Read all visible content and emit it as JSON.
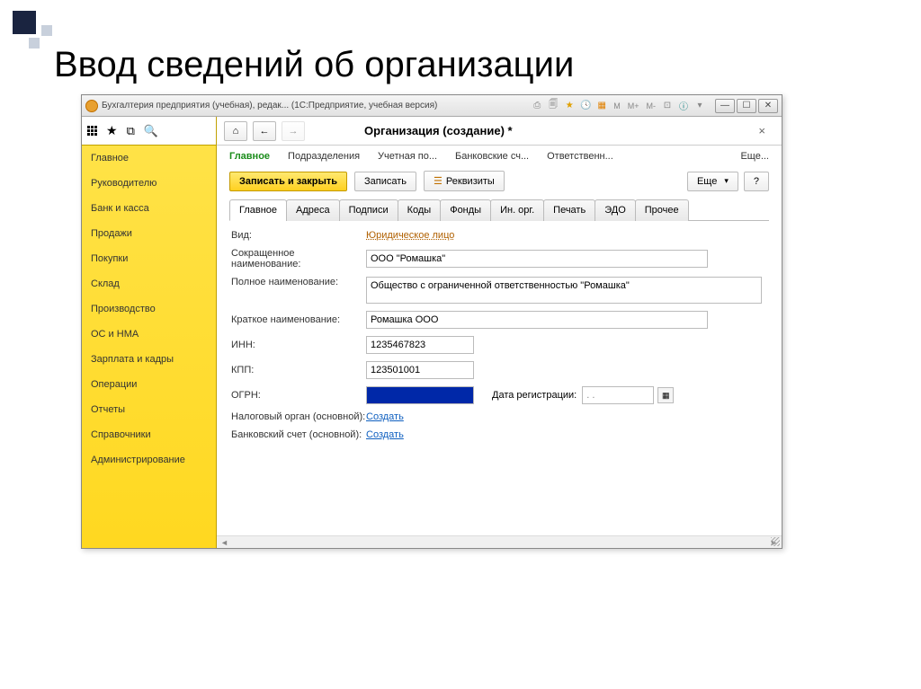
{
  "slide": {
    "title": "Ввод сведений об организации"
  },
  "window": {
    "title": "Бухгалтерия предприятия (учебная), редак... (1С:Предприятие, учебная версия)",
    "m_buttons": [
      "M",
      "M+",
      "M-"
    ]
  },
  "sidebar": {
    "items": [
      "Главное",
      "Руководителю",
      "Банк и касса",
      "Продажи",
      "Покупки",
      "Склад",
      "Производство",
      "ОС и НМА",
      "Зарплата и кадры",
      "Операции",
      "Отчеты",
      "Справочники",
      "Администрирование"
    ]
  },
  "page": {
    "title": "Организация (создание) *",
    "section_tabs": [
      "Главное",
      "Подразделения",
      "Учетная по...",
      "Банковские сч...",
      "Ответственн...",
      "Еще..."
    ],
    "active_section_tab": 0,
    "toolbar": {
      "save_close": "Записать и закрыть",
      "save": "Записать",
      "details": "Реквизиты",
      "more": "Еще",
      "help": "?"
    },
    "form_tabs": [
      "Главное",
      "Адреса",
      "Подписи",
      "Коды",
      "Фонды",
      "Ин. орг.",
      "Печать",
      "ЭДО",
      "Прочее"
    ],
    "active_form_tab": 0,
    "fields": {
      "vid_label": "Вид:",
      "vid_value": "Юридическое лицо",
      "short_label": "Сокращенное наименование:",
      "short_value": "ООО \"Ромашка\"",
      "full_label": "Полное наименование:",
      "full_value": "Общество с ограниченной ответственностью \"Ромашка\"",
      "brief_label": "Краткое наименование:",
      "brief_value": "Ромашка ООО",
      "inn_label": "ИНН:",
      "inn_value": "1235467823",
      "kpp_label": "КПП:",
      "kpp_value": "123501001",
      "ogrn_label": "ОГРН:",
      "reg_date_label": "Дата регистрации:",
      "reg_date_value": " .  .    ",
      "tax_label": "Налоговый орган (основной):",
      "bank_label": "Банковский счет (основной):",
      "create_link": "Создать"
    }
  }
}
